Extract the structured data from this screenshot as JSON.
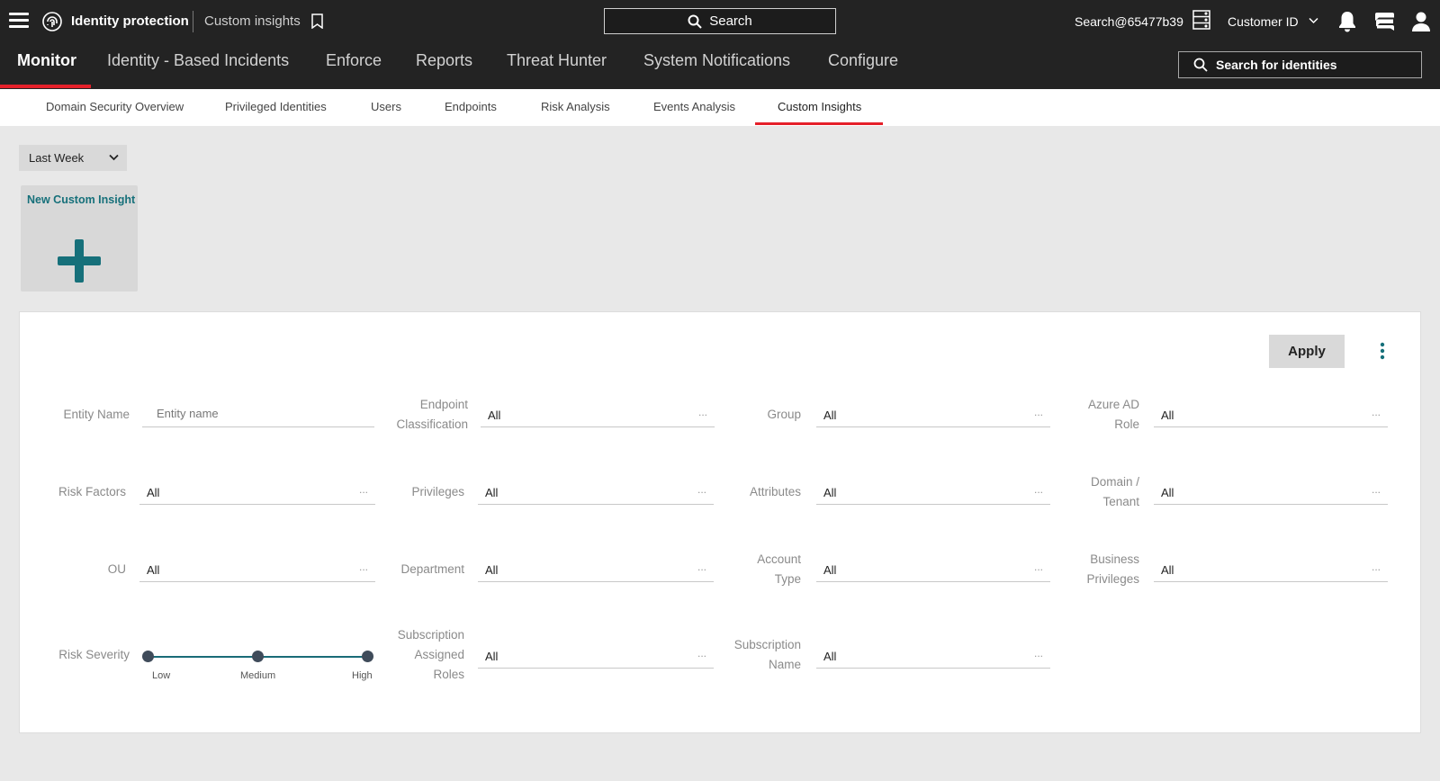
{
  "header": {
    "app_title": "Identity protection",
    "page_crumb": "Custom insights",
    "search_label": "Search",
    "user_account": "Search@65477b39",
    "customer_label": "Customer ID"
  },
  "main_nav": {
    "items": [
      "Monitor",
      "Identity - Based Incidents",
      "Enforce",
      "Reports",
      "Threat Hunter",
      "System Notifications",
      "Configure"
    ],
    "active": "Monitor",
    "identity_search_placeholder": "Search for identities"
  },
  "sub_nav": {
    "items": [
      "Domain Security Overview",
      "Privileged Identities",
      "Users",
      "Endpoints",
      "Risk Analysis",
      "Events Analysis",
      "Custom Insights"
    ],
    "active": "Custom Insights"
  },
  "period_select": {
    "value": "Last Week"
  },
  "new_insight_tile": {
    "label": "New Custom Insight"
  },
  "filters": {
    "apply_label": "Apply",
    "entity_name": {
      "label": "Entity Name",
      "placeholder": "Entity name"
    },
    "endpoint_classification": {
      "label_lines": [
        "Endpoint",
        "Classification"
      ],
      "value": "All"
    },
    "group": {
      "label": "Group",
      "value": "All"
    },
    "azure_ad_role": {
      "label_lines": [
        "Azure AD",
        "Role"
      ],
      "value": "All"
    },
    "risk_factors": {
      "label": "Risk Factors",
      "value": "All"
    },
    "privileges": {
      "label": "Privileges",
      "value": "All"
    },
    "attributes": {
      "label": "Attributes",
      "value": "All"
    },
    "domain_tenant": {
      "label_lines": [
        "Domain /",
        "Tenant"
      ],
      "value": "All"
    },
    "ou": {
      "label": "OU",
      "value": "All"
    },
    "department": {
      "label": "Department",
      "value": "All"
    },
    "account_type": {
      "label_lines": [
        "Account",
        "Type"
      ],
      "value": "All"
    },
    "business_privileges": {
      "label_lines": [
        "Business",
        "Privileges"
      ],
      "value": "All"
    },
    "risk_severity": {
      "label": "Risk Severity",
      "levels": [
        "Low",
        "Medium",
        "High"
      ],
      "selected_range": [
        "Low",
        "High"
      ]
    },
    "subscription_assigned_roles": {
      "label_lines": [
        "Subscription",
        "Assigned",
        "Roles"
      ],
      "value": "All"
    },
    "subscription_name": {
      "label_lines": [
        "Subscription",
        "Name"
      ],
      "value": "All"
    },
    "more_glyph": "..."
  },
  "colors": {
    "accent_red": "#e5202a",
    "teal": "#16707a",
    "topbar": "#232323"
  }
}
